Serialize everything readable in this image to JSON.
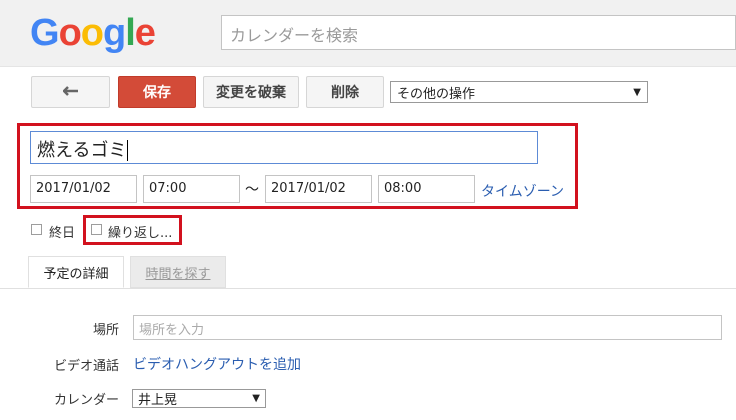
{
  "header": {
    "logo_text": "Google",
    "logo_colors": [
      "#4285F4",
      "#EA4335",
      "#FBBC05",
      "#4285F4",
      "#34A853",
      "#EA4335"
    ],
    "search_placeholder": "カレンダーを検索"
  },
  "toolbar": {
    "back_icon": "back-arrow-icon",
    "save_label": "保存",
    "discard_label": "変更を破棄",
    "delete_label": "削除",
    "more_actions_value": "その他の操作"
  },
  "event": {
    "title": "燃えるゴミ",
    "start_date": "2017/01/02",
    "start_time": "07:00",
    "separator": "～",
    "end_date": "2017/01/02",
    "end_time": "08:00",
    "timezone_link": "タイムゾーン",
    "all_day_label": "終日",
    "repeat_label": "繰り返し..."
  },
  "tabs": [
    {
      "label": "予定の詳細",
      "active": true
    },
    {
      "label": "時間を探す",
      "active": false
    }
  ],
  "details": {
    "location_label": "場所",
    "location_placeholder": "場所を入力",
    "video_label": "ビデオ通話",
    "video_link": "ビデオハングアウトを追加",
    "calendar_label": "カレンダー",
    "calendar_value": "井上晃"
  },
  "colors": {
    "highlight": "#d2111e",
    "save_button": "#d34b38",
    "link": "#2a5db0"
  }
}
